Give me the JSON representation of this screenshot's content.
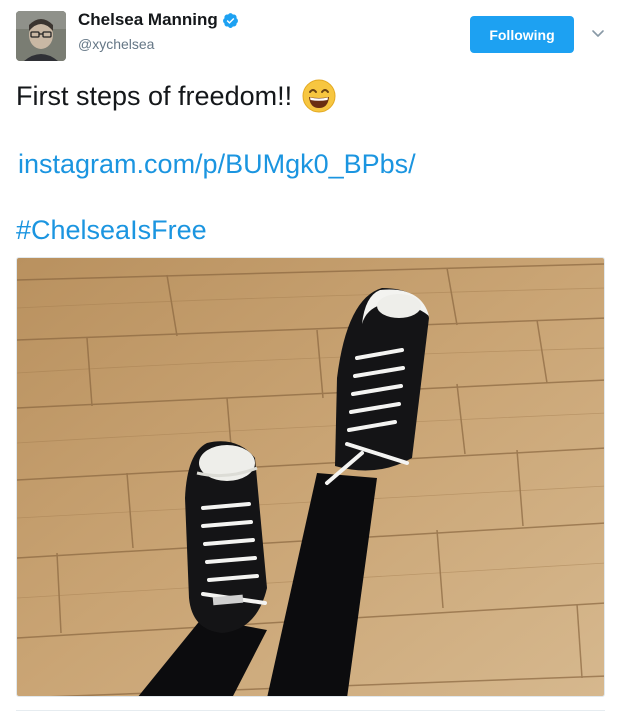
{
  "user": {
    "display_name": "Chelsea Manning",
    "handle": "@xychelsea",
    "verified": true
  },
  "follow_button": {
    "label": "Following"
  },
  "tweet": {
    "text": "First steps of freedom!!",
    "emoji": "grinning-face-with-smiling-eyes",
    "link": "instagram.com/p/BUMgk0_BPbs/",
    "hashtag": "#ChelseaIsFree"
  },
  "media": {
    "description_icon": "photo-sneakers-on-wood-floor"
  },
  "colors": {
    "accent": "#1da1f2",
    "link": "#1b95e0",
    "verified": "#1da1f2",
    "text": "#14171a",
    "muted": "#657786"
  }
}
